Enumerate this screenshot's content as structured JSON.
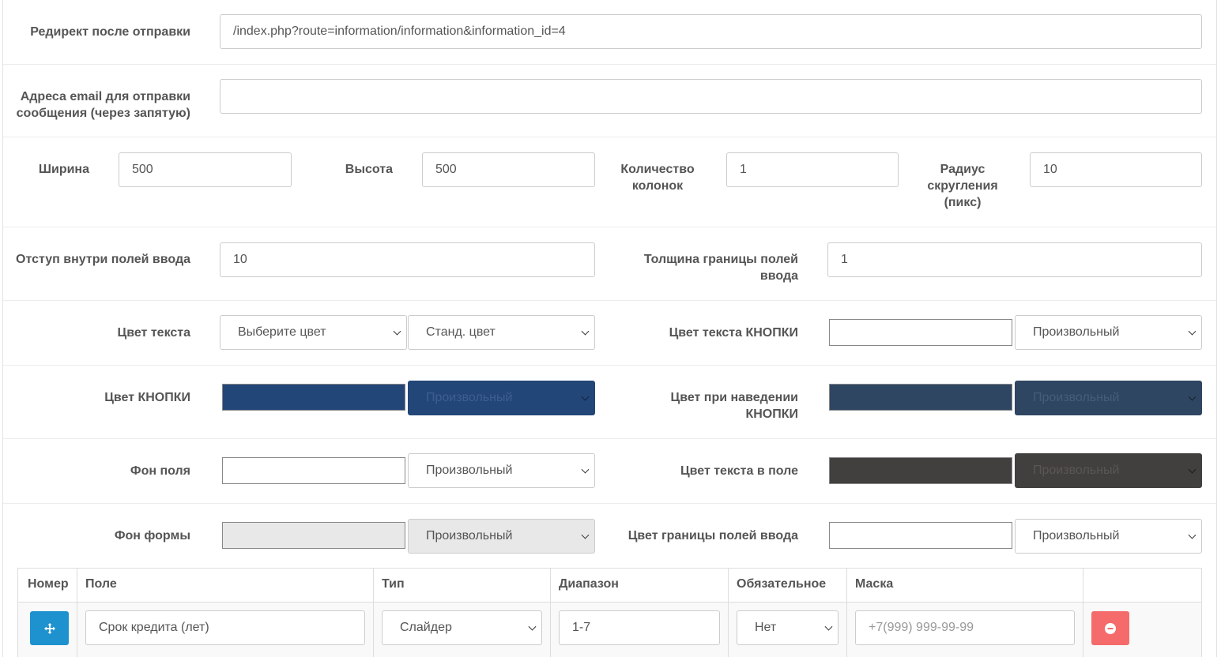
{
  "redirect": {
    "label": "Редирект после отправки",
    "value": "/index.php?route=information/information&information_id=4"
  },
  "emails": {
    "label": "Адреса email для отправки сообщения (через запятую)",
    "value": ""
  },
  "width": {
    "label": "Ширина",
    "value": "500"
  },
  "height": {
    "label": "Высота",
    "value": "500"
  },
  "columns": {
    "label": "Количество колонок",
    "value": "1"
  },
  "radius": {
    "label": "Радиус скругления (пикс)",
    "value": "10"
  },
  "padding": {
    "label": "Отступ внутри полей ввода",
    "value": "10"
  },
  "border_width": {
    "label": "Толщина границы полей ввода",
    "value": "1"
  },
  "text_color": {
    "label": "Цвет текста",
    "select1": "Выберите цвет",
    "select2": "Станд. цвет"
  },
  "button_text_color": {
    "label": "Цвет текста КНОПКИ",
    "select": "Произвольный",
    "swatch": "#ffffff"
  },
  "button_color": {
    "label": "Цвет КНОПКИ",
    "select": "Произвольный",
    "swatch": "#234678"
  },
  "button_hover_color": {
    "label": "Цвет при наведении КНОПКИ",
    "select": "Произвольный",
    "swatch": "#2e4662"
  },
  "field_bg": {
    "label": "Фон поля",
    "select": "Произвольный",
    "swatch": "#ffffff"
  },
  "field_text_color": {
    "label": "Цвет текста в поле",
    "select": "Произвольный",
    "swatch": "#423f3f"
  },
  "form_bg": {
    "label": "Фон формы",
    "select": "Произвольный",
    "swatch": "#e8e8e8"
  },
  "field_border_color": {
    "label": "Цвет границы полей ввода",
    "select": "Произвольный",
    "swatch": "#ffffff"
  },
  "table": {
    "headers": [
      "Номер",
      "Поле",
      "Тип",
      "Диапазон",
      "Обязательное",
      "Маска",
      ""
    ],
    "row": {
      "field": "Срок кредита (лет)",
      "type": "Слайдер",
      "range": "1-7",
      "required": "Нет",
      "mask_placeholder": "+7(999) 999-99-99"
    }
  },
  "colors": {
    "primary": "#1e91cf",
    "danger": "#f56b6b"
  }
}
